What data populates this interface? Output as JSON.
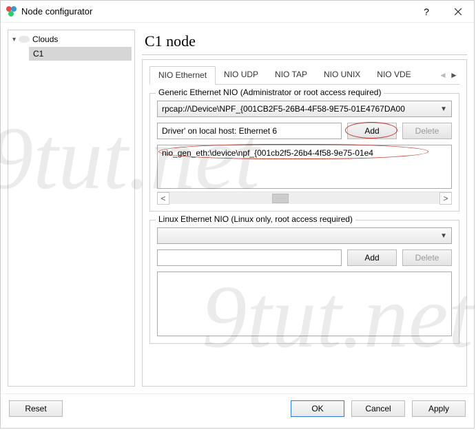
{
  "window": {
    "title": "Node configurator"
  },
  "tree": {
    "root_label": "Clouds",
    "child_label": "C1"
  },
  "main": {
    "heading": "C1 node",
    "tabs": [
      "NIO Ethernet",
      "NIO UDP",
      "NIO TAP",
      "NIO UNIX",
      "NIO VDE"
    ],
    "active_tab_index": 0
  },
  "generic_group": {
    "title": "Generic Ethernet NIO (Administrator or root access required)",
    "dropdown_value": "rpcap://\\Device\\NPF_{001CB2F5-26B4-4F58-9E75-01E4767DA00",
    "input_value": "Driver' on local host: Ethernet 6",
    "add_label": "Add",
    "delete_label": "Delete",
    "list_item": "nio_gen_eth:\\device\\npf_{001cb2f5-26b4-4f58-9e75-01e4"
  },
  "linux_group": {
    "title": "Linux Ethernet NIO (Linux only, root access required)",
    "dropdown_value": "",
    "input_value": "",
    "add_label": "Add",
    "delete_label": "Delete"
  },
  "footer": {
    "reset": "Reset",
    "ok": "OK",
    "cancel": "Cancel",
    "apply": "Apply"
  }
}
